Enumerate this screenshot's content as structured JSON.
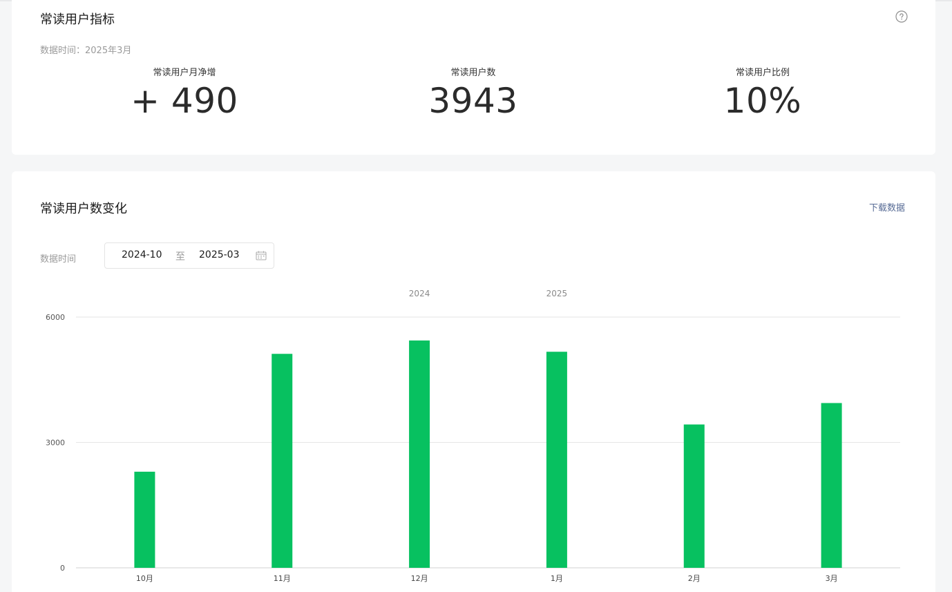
{
  "metrics_card": {
    "title": "常读用户指标",
    "data_time": "数据时间：2025年3月",
    "help_icon": "question-circle-icon",
    "metrics": [
      {
        "label": "常读用户月净增",
        "value": "+ 490"
      },
      {
        "label": "常读用户数",
        "value": "3943"
      },
      {
        "label": "常读用户比例",
        "value": "10%"
      }
    ]
  },
  "chart_card": {
    "title": "常读用户数变化",
    "download_label": "下载数据",
    "range_label": "数据时间",
    "range_start": "2024-10",
    "range_separator": "至",
    "range_end": "2025-03",
    "calendar_icon": "calendar-icon"
  },
  "chart_data": {
    "type": "bar",
    "categories": [
      "10月",
      "11月",
      "12月",
      "1月",
      "2月",
      "3月"
    ],
    "values": [
      2300,
      5120,
      5440,
      5170,
      3430,
      3943
    ],
    "year_labels": [
      {
        "text": "2024",
        "category_index": 2
      },
      {
        "text": "2025",
        "category_index": 3
      }
    ],
    "yticks": [
      0,
      3000,
      6000
    ],
    "ylim": [
      0,
      6000
    ],
    "grid": true,
    "bar_color": "#07c160",
    "title": "",
    "xlabel": "",
    "ylabel": ""
  },
  "colors": {
    "accent_green": "#07c160",
    "link_blue": "#576b95",
    "gridline": "#e6e6e6"
  }
}
